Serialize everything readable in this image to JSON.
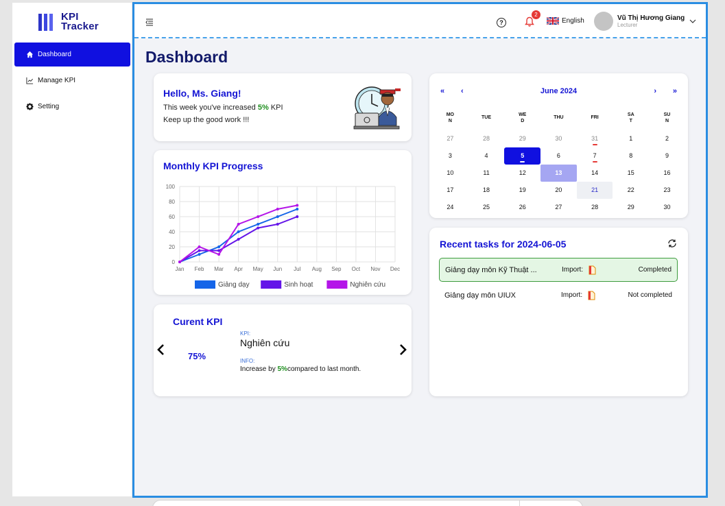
{
  "app": {
    "logo_line1": "KPI",
    "logo_line2": "Tracker"
  },
  "sidebar": {
    "items": [
      {
        "label": "Dashboard",
        "icon": "home-icon",
        "active": true
      },
      {
        "label": "Manage KPI",
        "icon": "line-chart-icon",
        "active": false
      },
      {
        "label": "Setting",
        "icon": "gear-icon",
        "active": false
      }
    ]
  },
  "header": {
    "notification_count": "2",
    "language": "English",
    "user_name": "Vũ Thị Hương Giang",
    "user_role": "Lecturer"
  },
  "page": {
    "title": "Dashboard"
  },
  "welcome": {
    "title": "Hello, Ms. Giang!",
    "line1_prefix": "This week you've increased ",
    "line1_value": "5%",
    "line1_suffix": " KPI",
    "line2": "Keep up the good work !!!"
  },
  "chart_card": {
    "title": "Monthly KPI Progress"
  },
  "chart_data": {
    "type": "line",
    "title": "Monthly KPI Progress",
    "categories": [
      "Jan",
      "Feb",
      "Mar",
      "Apr",
      "May",
      "Jun",
      "Jul",
      "Aug",
      "Sep",
      "Oct",
      "Nov",
      "Dec"
    ],
    "ylim": [
      0,
      100
    ],
    "yticks": [
      0,
      20,
      40,
      60,
      80,
      100
    ],
    "grid": true,
    "legend_position": "bottom",
    "series": [
      {
        "name": "Giảng dạy",
        "color": "#1565e8",
        "values": [
          0,
          10,
          20,
          40,
          50,
          60,
          70
        ]
      },
      {
        "name": "Sinh hoạt",
        "color": "#6415e8",
        "values": [
          0,
          15,
          15,
          30,
          45,
          50,
          60
        ]
      },
      {
        "name": "Nghiên cứu",
        "color": "#b415e8",
        "values": [
          0,
          20,
          10,
          50,
          60,
          70,
          75
        ]
      }
    ]
  },
  "current_kpi": {
    "title": "Curent KPI",
    "percent": "75%",
    "kpi_label": "KPI:",
    "kpi_name": "Nghiên cứu",
    "info_label": "INFO:",
    "info_prefix": "Increase by ",
    "info_value": "5%",
    "info_suffix": "compared to last month."
  },
  "calendar": {
    "month_label": "June 2024",
    "nav": {
      "prev_year": "«",
      "prev_month": "‹",
      "next_month": "›",
      "next_year": "»"
    },
    "weekdays": [
      [
        "MO",
        "N"
      ],
      [
        "TUE",
        ""
      ],
      [
        "WE",
        "D"
      ],
      [
        "THU",
        ""
      ],
      [
        "FRI",
        ""
      ],
      [
        "SA",
        "T"
      ],
      [
        "SU",
        "N"
      ]
    ],
    "weeks": [
      [
        {
          "d": "27",
          "m": true
        },
        {
          "d": "28",
          "m": true
        },
        {
          "d": "29",
          "m": true
        },
        {
          "d": "30",
          "m": true
        },
        {
          "d": "31",
          "m": true,
          "mark": true
        },
        {
          "d": "1"
        },
        {
          "d": "2"
        }
      ],
      [
        {
          "d": "3"
        },
        {
          "d": "4"
        },
        {
          "d": "5",
          "sel": true,
          "mark": true
        },
        {
          "d": "6"
        },
        {
          "d": "7",
          "mark": true
        },
        {
          "d": "8"
        },
        {
          "d": "9"
        }
      ],
      [
        {
          "d": "10"
        },
        {
          "d": "11"
        },
        {
          "d": "12"
        },
        {
          "d": "13",
          "hl": true
        },
        {
          "d": "14"
        },
        {
          "d": "15"
        },
        {
          "d": "16"
        }
      ],
      [
        {
          "d": "17"
        },
        {
          "d": "18"
        },
        {
          "d": "19"
        },
        {
          "d": "20"
        },
        {
          "d": "21",
          "today": true
        },
        {
          "d": "22"
        },
        {
          "d": "23"
        }
      ],
      [
        {
          "d": "24"
        },
        {
          "d": "25"
        },
        {
          "d": "26"
        },
        {
          "d": "27"
        },
        {
          "d": "28"
        },
        {
          "d": "29"
        },
        {
          "d": "30"
        }
      ]
    ]
  },
  "tasks": {
    "title": "Recent tasks for 2024-06-05",
    "import_label": "Import:",
    "items": [
      {
        "name": "Giảng dạy môn Kỹ Thuật ...",
        "status": "Completed",
        "done": true
      },
      {
        "name": "Giảng dạy môn UIUX",
        "status": "Not completed",
        "done": false
      }
    ]
  }
}
